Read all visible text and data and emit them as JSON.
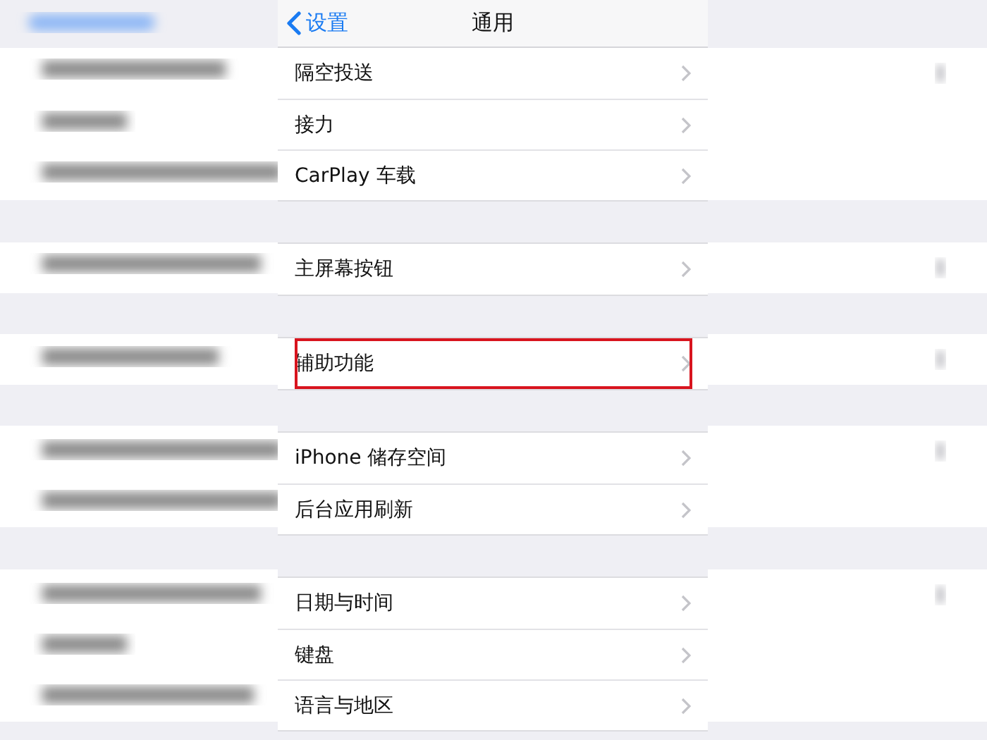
{
  "nav": {
    "back": "设置",
    "title": "通用"
  },
  "groups": [
    {
      "rows": [
        {
          "label": "隔空投送",
          "highlighted": false
        },
        {
          "label": "接力",
          "highlighted": false
        },
        {
          "label": "CarPlay 车载",
          "highlighted": false
        }
      ]
    },
    {
      "rows": [
        {
          "label": "主屏幕按钮",
          "highlighted": false
        }
      ]
    },
    {
      "rows": [
        {
          "label": "辅助功能",
          "highlighted": true
        }
      ]
    },
    {
      "rows": [
        {
          "label": "iPhone 储存空间",
          "highlighted": false
        },
        {
          "label": "后台应用刷新",
          "highlighted": false
        }
      ]
    },
    {
      "rows": [
        {
          "label": "日期与时间",
          "highlighted": false
        },
        {
          "label": "键盘",
          "highlighted": false
        },
        {
          "label": "语言与地区",
          "highlighted": false
        }
      ]
    }
  ]
}
